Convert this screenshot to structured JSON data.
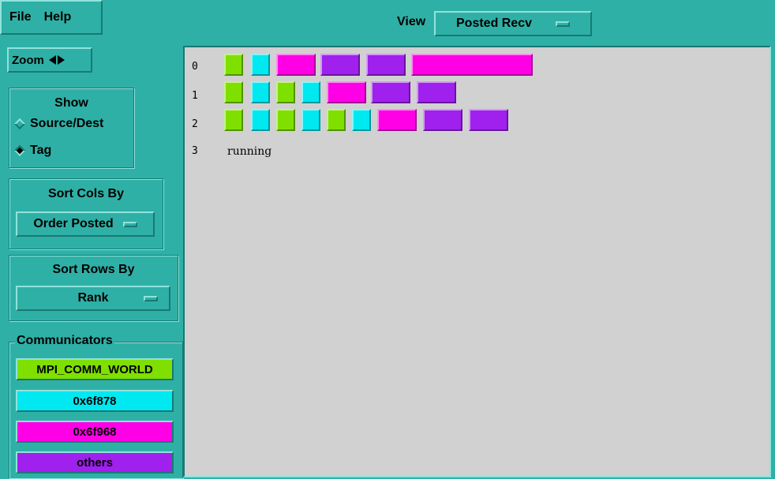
{
  "menubar": {
    "file": "File",
    "help": "Help"
  },
  "view": {
    "label": "View",
    "selected": "Posted Recv"
  },
  "zoom": {
    "label": "Zoom"
  },
  "show": {
    "title": "Show",
    "options": [
      "Source/Dest",
      "Tag"
    ],
    "selected": "Tag"
  },
  "sort_cols": {
    "title": "Sort Cols By",
    "selected": "Order Posted"
  },
  "sort_rows": {
    "title": "Sort Rows By",
    "selected": "Rank"
  },
  "communicators": {
    "title": "Communicators",
    "items": [
      {
        "label": "MPI_COMM_WORLD",
        "color": "#7fe000"
      },
      {
        "label": "0x6f878",
        "color": "#00e8f0"
      },
      {
        "label": "0x6f968",
        "color": "#ff00e6"
      },
      {
        "label": "others",
        "color": "#a020ee"
      }
    ]
  },
  "canvas": {
    "rows": [
      {
        "rank": "0",
        "blocks": [
          "g",
          "c",
          "m",
          "p",
          "p",
          "m"
        ]
      },
      {
        "rank": "1",
        "blocks": [
          "g",
          "c",
          "g",
          "c",
          "m",
          "p",
          "p"
        ]
      },
      {
        "rank": "2",
        "blocks": [
          "g",
          "c",
          "g",
          "c",
          "g",
          "c",
          "m",
          "p",
          "p"
        ]
      },
      {
        "rank": "3",
        "status": "running"
      }
    ]
  }
}
